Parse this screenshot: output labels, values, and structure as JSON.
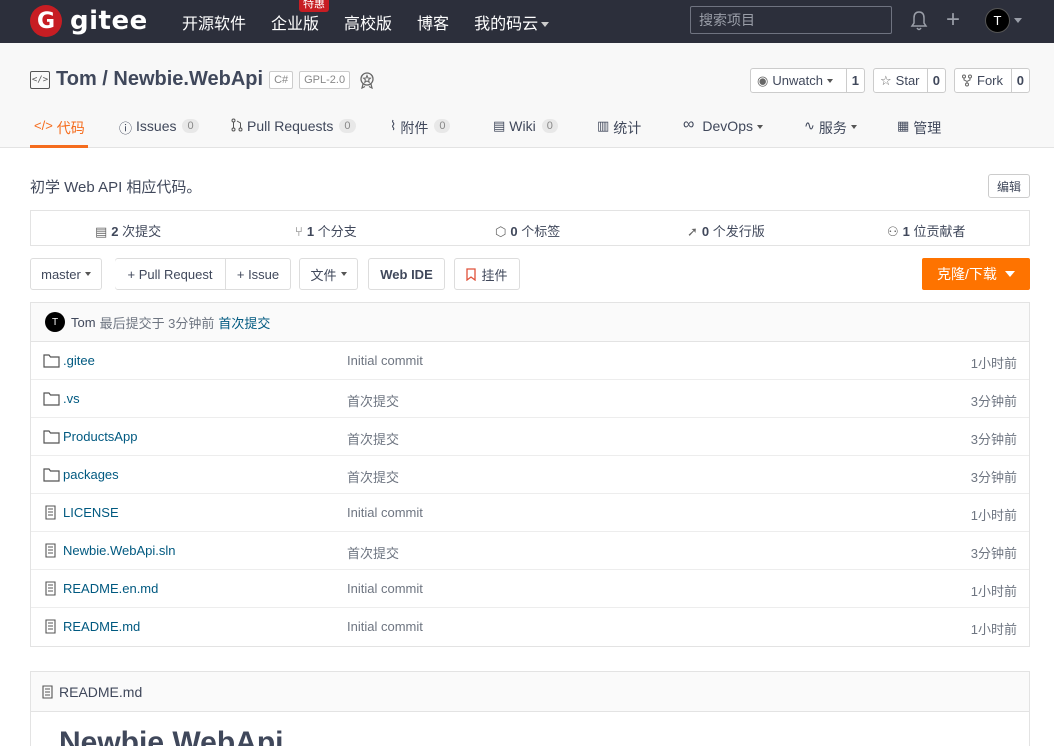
{
  "topnav": {
    "logo_letter": "G",
    "logo_text": "gitee",
    "links": [
      {
        "label": "开源软件"
      },
      {
        "label": "企业版",
        "badge": "特惠"
      },
      {
        "label": "高校版"
      },
      {
        "label": "博客"
      },
      {
        "label": "我的码云"
      }
    ],
    "search_placeholder": "搜索项目",
    "avatar_letter": "T"
  },
  "project": {
    "title": "Tom / Newbie.WebApi",
    "language_tag": "C#",
    "license_tag": "GPL-2.0",
    "watch": {
      "label": "Unwatch",
      "count": "1"
    },
    "star": {
      "label": "Star",
      "count": "0"
    },
    "fork": {
      "label": "Fork",
      "count": "0"
    }
  },
  "tabs": [
    {
      "label": "代码"
    },
    {
      "label": "Issues",
      "count": "0"
    },
    {
      "label": "Pull Requests",
      "count": "0"
    },
    {
      "label": "附件",
      "count": "0"
    },
    {
      "label": "Wiki",
      "count": "0"
    },
    {
      "label": "统计"
    },
    {
      "label": "DevOps"
    },
    {
      "label": "服务"
    },
    {
      "label": "管理"
    }
  ],
  "description": "初学 Web API 相应代码。",
  "edit_label": "编辑",
  "stats": [
    {
      "num": "2",
      "label": "次提交"
    },
    {
      "num": "1",
      "label": "个分支"
    },
    {
      "num": "0",
      "label": "个标签"
    },
    {
      "num": "0",
      "label": "个发行版"
    },
    {
      "num": "1",
      "label": "位贡献者"
    }
  ],
  "toolbar": {
    "branch": "master",
    "pull_request": "+ Pull Request",
    "issue": "+ Issue",
    "file": "文件",
    "web_ide": "Web IDE",
    "widget": "挂件",
    "clone": "克隆/下载"
  },
  "last_commit": {
    "avatar_letter": "T",
    "author": "Tom",
    "text": "最后提交于 3分钟前",
    "message": "首次提交"
  },
  "files": [
    {
      "type": "folder",
      "name": ".gitee",
      "message": "Initial commit",
      "time": "1小时前"
    },
    {
      "type": "folder",
      "name": ".vs",
      "message": "首次提交",
      "time": "3分钟前"
    },
    {
      "type": "folder",
      "name": "ProductsApp",
      "message": "首次提交",
      "time": "3分钟前"
    },
    {
      "type": "folder",
      "name": "packages",
      "message": "首次提交",
      "time": "3分钟前"
    },
    {
      "type": "file",
      "name": "LICENSE",
      "message": "Initial commit",
      "time": "1小时前"
    },
    {
      "type": "file",
      "name": "Newbie.WebApi.sln",
      "message": "首次提交",
      "time": "3分钟前"
    },
    {
      "type": "file",
      "name": "README.en.md",
      "message": "Initial commit",
      "time": "1小时前"
    },
    {
      "type": "file",
      "name": "README.md",
      "message": "Initial commit",
      "time": "1小时前"
    }
  ],
  "readme": {
    "file_name": "README.md",
    "heading": "Newbie.WebApi"
  },
  "colors": {
    "accent": "#f56c1d",
    "clone_button": "#fe7300",
    "nav_bg": "#2c2f3b",
    "link": "#005980"
  }
}
